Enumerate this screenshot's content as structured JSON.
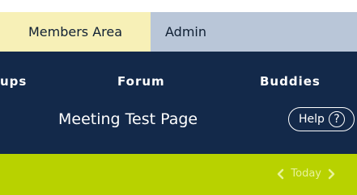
{
  "tabs": {
    "members_area": "Members Area",
    "admin": "Admin"
  },
  "nav": {
    "items": [
      {
        "label": "ups"
      },
      {
        "label": "Forum"
      },
      {
        "label": "Buddies"
      }
    ]
  },
  "header": {
    "title": "Meeting Test Page",
    "help_label": "Help",
    "help_icon_glyph": "?"
  },
  "date_nav": {
    "today_label": "Today",
    "prev_icon": "chevron-left-icon",
    "next_icon": "chevron-right-icon"
  },
  "colors": {
    "tab_members_bg": "#f7f0b7",
    "tab_admin_bg": "#b9c6d8",
    "nav_bg": "#13294a",
    "date_bar_bg": "#b8d200"
  }
}
